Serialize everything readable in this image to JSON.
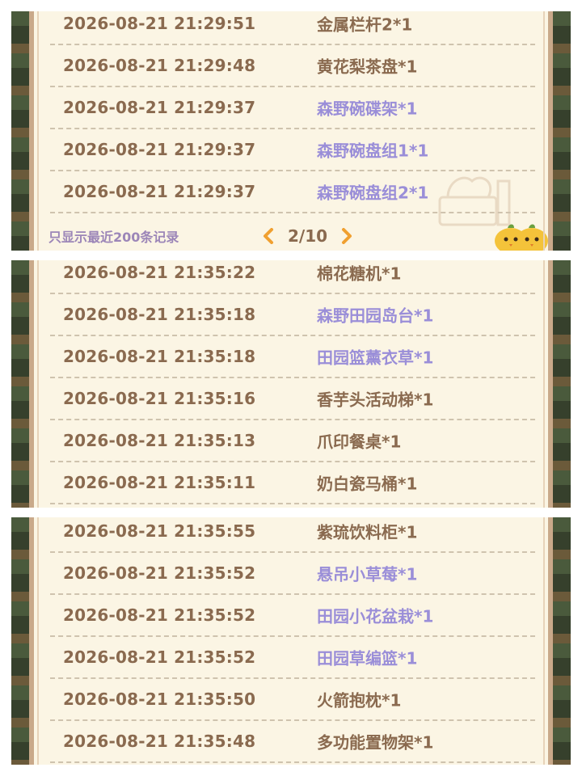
{
  "panels": [
    {
      "rows": [
        {
          "time": "2026-08-21  21:29:51",
          "item": "金属栏杆2*1",
          "rare": false
        },
        {
          "time": "2026-08-21  21:29:48",
          "item": "黄花梨茶盘*1",
          "rare": false
        },
        {
          "time": "2026-08-21  21:29:37",
          "item": "森野碗碟架*1",
          "rare": true
        },
        {
          "time": "2026-08-21  21:29:37",
          "item": "森野碗盘组1*1",
          "rare": true
        },
        {
          "time": "2026-08-21  21:29:37",
          "item": "森野碗盘组2*1",
          "rare": true
        }
      ],
      "footer_note": "只显示最近200条记录",
      "page": "2/10"
    },
    {
      "rows": [
        {
          "time": "2026-08-21  21:35:22",
          "item": "棉花糖机*1",
          "rare": false
        },
        {
          "time": "2026-08-21  21:35:18",
          "item": "森野田园岛台*1",
          "rare": true
        },
        {
          "time": "2026-08-21  21:35:18",
          "item": "田园篮薰衣草*1",
          "rare": true
        },
        {
          "time": "2026-08-21  21:35:16",
          "item": "香芋头活动梯*1",
          "rare": false
        },
        {
          "time": "2026-08-21  21:35:13",
          "item": "爪印餐桌*1",
          "rare": false
        },
        {
          "time": "2026-08-21  21:35:11",
          "item": "奶白瓷马桶*1",
          "rare": false
        }
      ]
    },
    {
      "rows": [
        {
          "time": "2026-08-21  21:35:55",
          "item": "紫琉饮料柜*1",
          "rare": false
        },
        {
          "time": "2026-08-21  21:35:52",
          "item": "悬吊小草莓*1",
          "rare": true
        },
        {
          "time": "2026-08-21  21:35:52",
          "item": "田园小花盆栽*1",
          "rare": true
        },
        {
          "time": "2026-08-21  21:35:52",
          "item": "田园草编篮*1",
          "rare": true
        },
        {
          "time": "2026-08-21  21:35:50",
          "item": "火箭抱枕*1",
          "rare": false
        },
        {
          "time": "2026-08-21  21:35:48",
          "item": "多功能置物架*1",
          "rare": false
        }
      ]
    }
  ],
  "colors": {
    "normal_item": "#8a6a4f",
    "rare_item": "#9a8ed8",
    "paper": "#fbf5e4",
    "arrow": "#f0a030"
  },
  "icons": {
    "prev": "chevron-left-icon",
    "next": "chevron-right-icon",
    "mascot": "chick-mascot-icon"
  }
}
